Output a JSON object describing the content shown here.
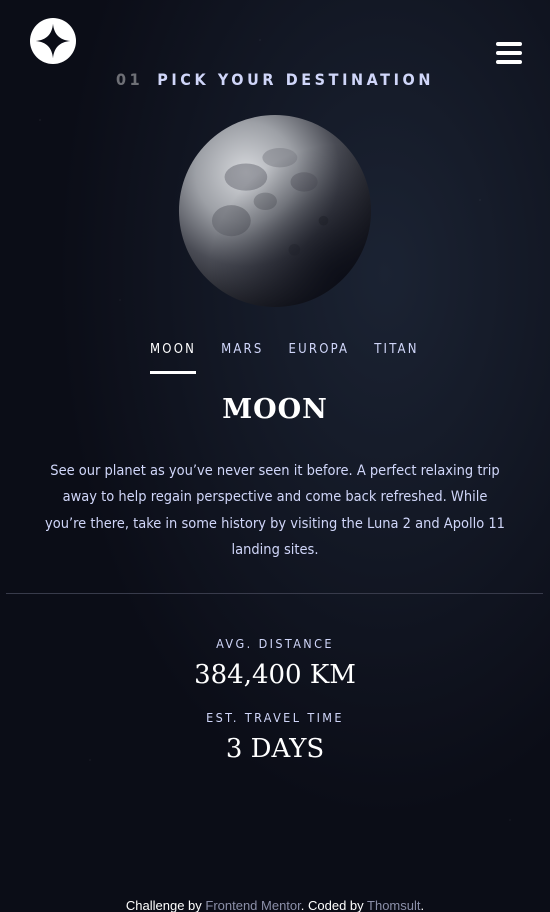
{
  "header": {
    "logo_icon": "star-logo-icon",
    "menu_icon": "hamburger-menu-icon"
  },
  "section": {
    "number": "01",
    "title": "Pick your destination"
  },
  "planet_image": "moon-image",
  "tabs": [
    {
      "label": "Moon",
      "active": true
    },
    {
      "label": "Mars",
      "active": false
    },
    {
      "label": "Europa",
      "active": false
    },
    {
      "label": "Titan",
      "active": false
    }
  ],
  "destination": {
    "name": "Moon",
    "description": "See our planet as you’ve never seen it before. A perfect relaxing trip away to help regain perspective and come back refreshed. While you’re there, take in some history by visiting the Luna 2 and Apollo 11 landing sites.",
    "distance_label": "Avg. distance",
    "distance_value": "384,400 km",
    "travel_label": "Est. travel time",
    "travel_value": "3 days"
  },
  "footer": {
    "prefix": "Challenge by ",
    "link1": "Frontend Mentor",
    "middle": ". Coded by ",
    "link2": "Thomsult",
    "suffix": "."
  },
  "colors": {
    "background": "#0b0d17",
    "text": "#d0d6f9",
    "white": "#ffffff",
    "link": "#8b8fa8"
  }
}
